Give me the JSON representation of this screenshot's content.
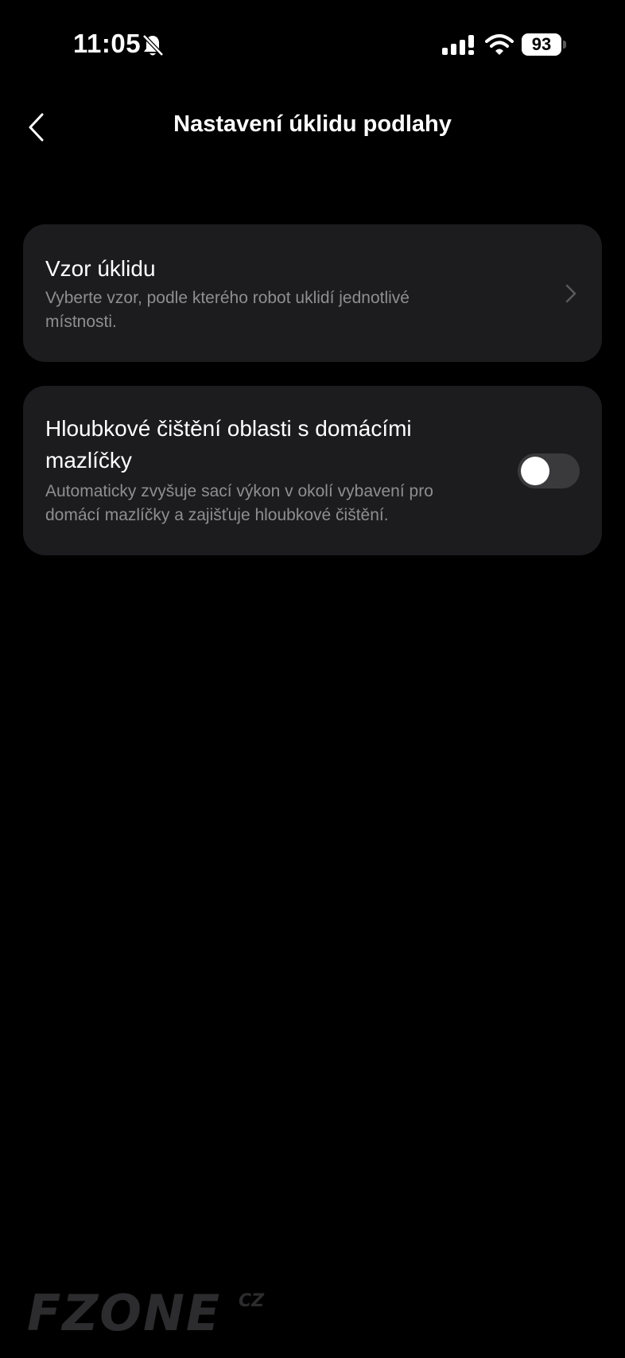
{
  "status_bar": {
    "time": "11:05",
    "battery_level": "93",
    "icons": [
      "bell-muted-icon",
      "signal-icon",
      "wifi-icon",
      "battery-icon"
    ]
  },
  "header": {
    "title": "Nastavení úklidu podlahy",
    "back_icon": "chevron-left-icon"
  },
  "settings": {
    "items": [
      {
        "title": "Vzor úklidu",
        "description": "Vyberte vzor, podle kterého robot uklidí jednotlivé místnosti.",
        "control": "chevron-right-icon"
      },
      {
        "title": "Hloubkové čištění oblasti s domácími mazlíčky",
        "description": "Automaticky zvyšuje sací výkon v okolí vybavení pro domácí mazlíčky a zajišťuje hloubkové čištění.",
        "control": "toggle",
        "toggle_on": false
      }
    ]
  },
  "watermark": {
    "text": "FZONE",
    "suffix": "CZ"
  },
  "colors": {
    "background": "#000000",
    "card": "#1c1c1e",
    "secondary_text": "#8e8e93",
    "toggle_off": "#3a3a3c",
    "watermark": "#2c2c2e"
  }
}
